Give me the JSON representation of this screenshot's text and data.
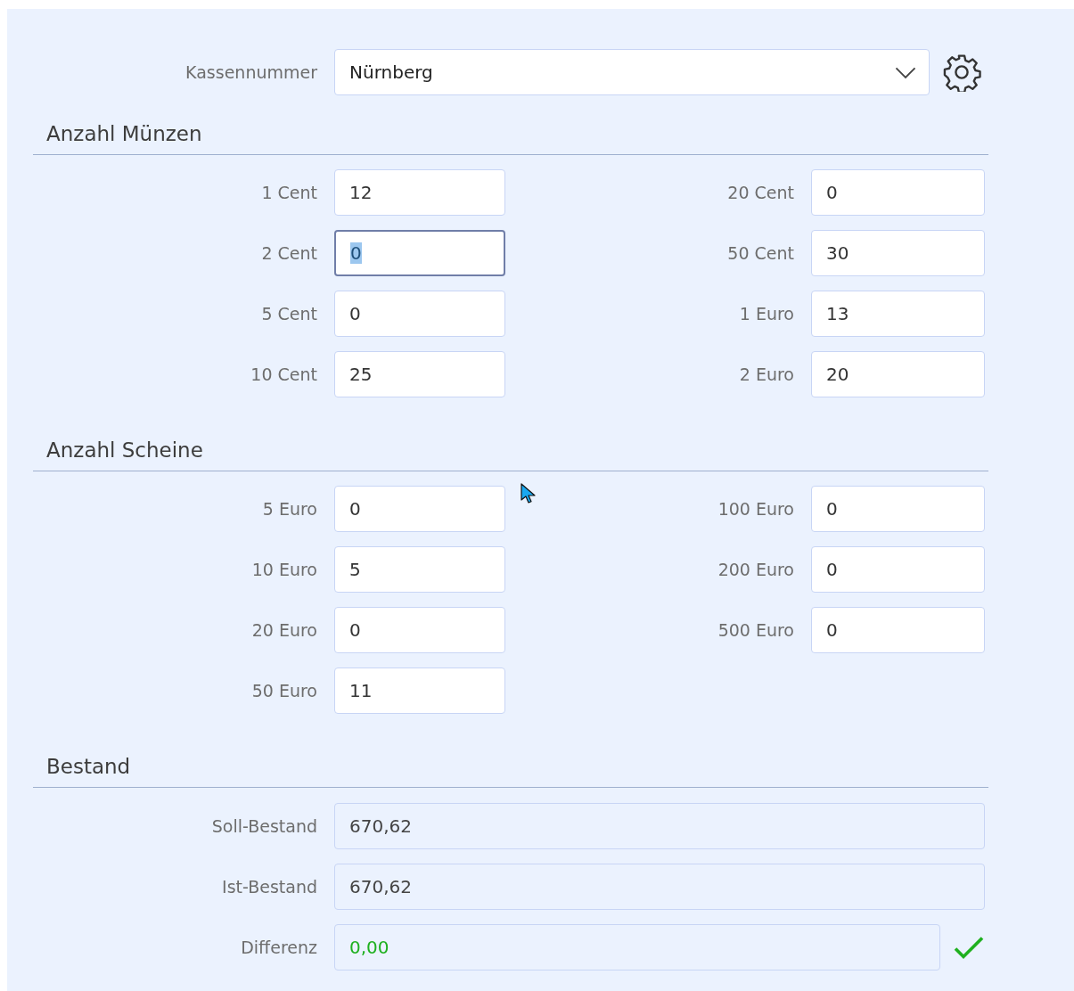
{
  "register": {
    "label": "Kassennummer",
    "value": "Nürnberg"
  },
  "sections": [
    {
      "title": "Anzahl Münzen",
      "kind": "grid",
      "left": [
        {
          "label": "1 Cent",
          "value": "12",
          "focused": false
        },
        {
          "label": "2 Cent",
          "value": "0",
          "focused": true
        },
        {
          "label": "5 Cent",
          "value": "0",
          "focused": false
        },
        {
          "label": "10 Cent",
          "value": "25",
          "focused": false
        }
      ],
      "right": [
        {
          "label": "20 Cent",
          "value": "0",
          "focused": false
        },
        {
          "label": "50 Cent",
          "value": "30",
          "focused": false
        },
        {
          "label": "1 Euro",
          "value": "13",
          "focused": false
        },
        {
          "label": "2 Euro",
          "value": "20",
          "focused": false
        }
      ]
    },
    {
      "title": "Anzahl Scheine",
      "kind": "grid",
      "left": [
        {
          "label": "5 Euro",
          "value": "0",
          "focused": false
        },
        {
          "label": "10 Euro",
          "value": "5",
          "focused": false
        },
        {
          "label": "20 Euro",
          "value": "0",
          "focused": false
        },
        {
          "label": "50 Euro",
          "value": "11",
          "focused": false
        }
      ],
      "right": [
        {
          "label": "100 Euro",
          "value": "0",
          "focused": false
        },
        {
          "label": "200 Euro",
          "value": "0",
          "focused": false
        },
        {
          "label": "500 Euro",
          "value": "0",
          "focused": false
        }
      ]
    },
    {
      "title": "Bestand",
      "kind": "totals",
      "rows": [
        {
          "label": "Soll-Bestand",
          "value": "670,62",
          "kind": "amount"
        },
        {
          "label": "Ist-Bestand",
          "value": "670,62",
          "kind": "amount"
        },
        {
          "label": "Differenz",
          "value": "0,00",
          "kind": "difference",
          "balanced": true
        }
      ]
    }
  ]
}
